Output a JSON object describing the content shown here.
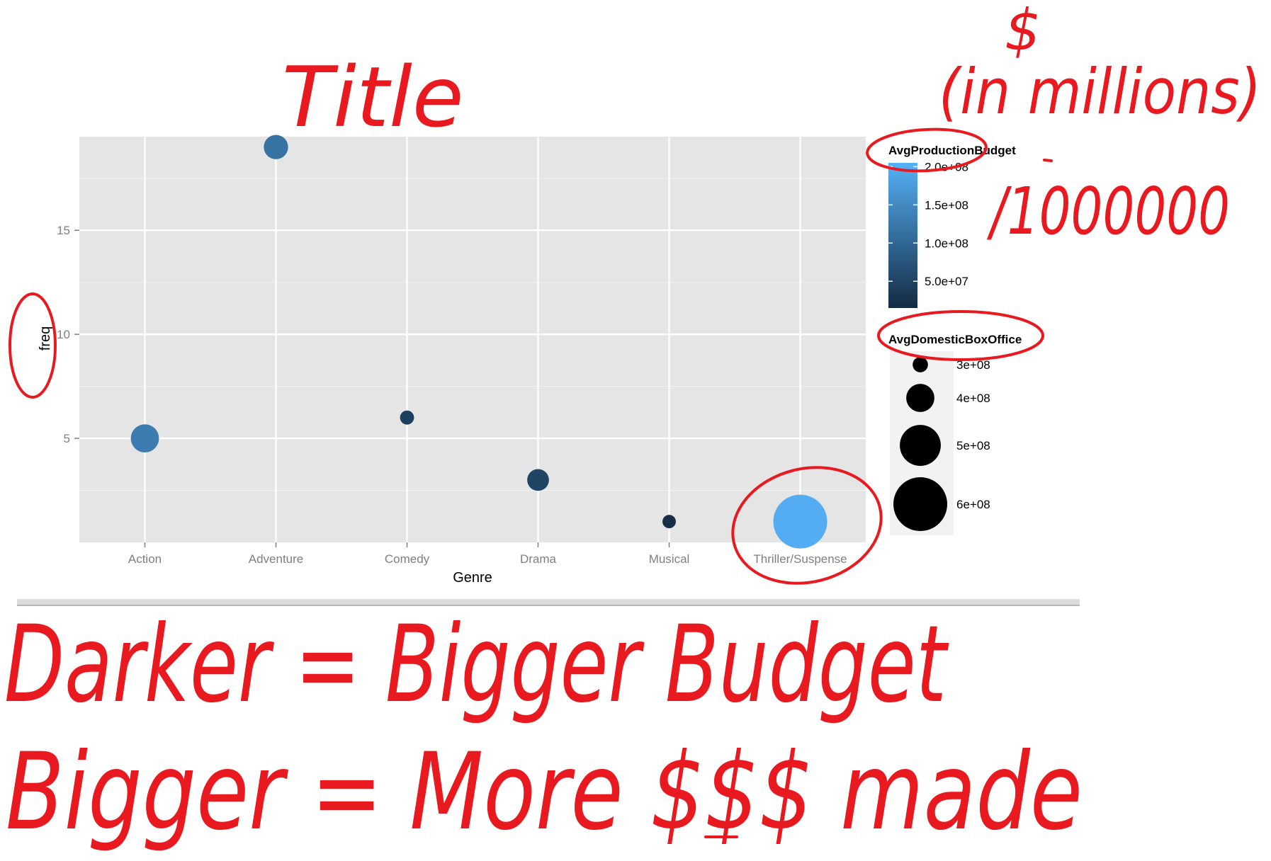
{
  "chart_data": {
    "type": "scatter",
    "title": "",
    "xlabel": "Genre",
    "ylabel": "freq",
    "categories": [
      "Action",
      "Adventure",
      "Comedy",
      "Drama",
      "Musical",
      "Thriller/Suspense"
    ],
    "y_ticks": [
      "5",
      "10",
      "15"
    ],
    "ylim": [
      0,
      19.5
    ],
    "grid": true,
    "legend_position": "right",
    "points": [
      {
        "x": "Action",
        "y": 5,
        "budget": 130000000,
        "box_office": 400000000
      },
      {
        "x": "Adventure",
        "y": 19,
        "budget": 115000000,
        "box_office": 370000000
      },
      {
        "x": "Comedy",
        "y": 6,
        "budget": 45000000,
        "box_office": 290000000
      },
      {
        "x": "Drama",
        "y": 3,
        "budget": 50000000,
        "box_office": 350000000
      },
      {
        "x": "Musical",
        "y": 1,
        "budget": 20000000,
        "box_office": 285000000
      },
      {
        "x": "Thriller/Suspense",
        "y": 1,
        "budget": 200000000,
        "box_office": 600000000
      }
    ],
    "color_legend": {
      "title": "AvgProductionBudget",
      "labels": [
        "2.0e+08",
        "1.5e+08",
        "1.0e+08",
        "5.0e+07"
      ],
      "values": [
        200000000,
        150000000,
        100000000,
        50000000
      ],
      "low_color": "#132B43",
      "high_color": "#56B1F7"
    },
    "size_legend": {
      "title": "AvgDomesticBoxOffice",
      "labels": [
        "3e+08",
        "4e+08",
        "5e+08",
        "6e+08"
      ],
      "values": [
        300000000,
        400000000,
        500000000,
        600000000
      ]
    }
  },
  "annotations": {
    "title_note": "Title",
    "dollar_note": "$",
    "millions_note": "(in millions)",
    "divide_note": "/1000000",
    "darker_note": "Darker = Bigger Budget",
    "bigger_note": "Bigger = More $$$ made"
  },
  "colors": {
    "panel_bg": "#E5E5E5",
    "grid": "#FFFFFF",
    "ink": "#E8191F"
  }
}
